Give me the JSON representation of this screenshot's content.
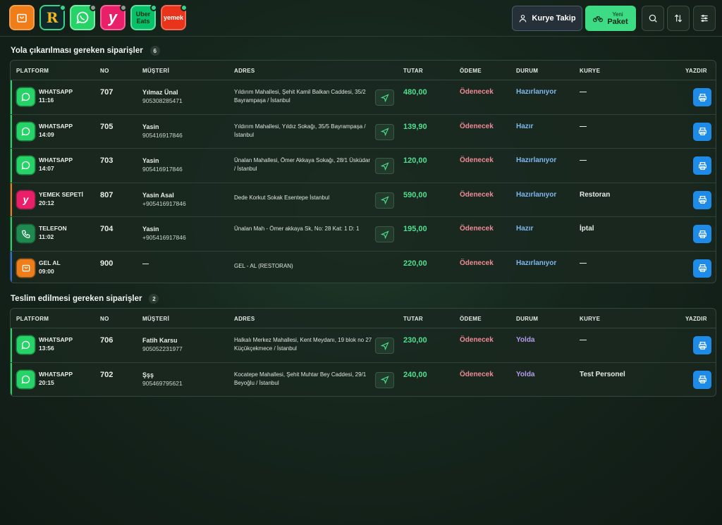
{
  "topbar": {
    "platforms": [
      {
        "name": "gel-al",
        "icon": "bag-icon",
        "color": "#ef7d1a",
        "status": "none"
      },
      {
        "name": "rpa",
        "icon": "r-app-icon",
        "color": "#0f2a2a",
        "status": "on",
        "label": "R"
      },
      {
        "name": "whatsapp",
        "icon": "whatsapp-icon",
        "color": "#25d366",
        "status": "off"
      },
      {
        "name": "yemeksepeti",
        "icon": "yemeksepeti-icon",
        "color": "#ea1f6a",
        "status": "off",
        "label": "y"
      },
      {
        "name": "ubereats",
        "icon": "ubereats-icon",
        "color": "#06c167",
        "status": "on",
        "label_top": "Uber",
        "label_bottom": "Eats"
      },
      {
        "name": "yemek",
        "icon": "yemek-icon",
        "color": "#e8341a",
        "status": "on",
        "label": "yemek"
      }
    ],
    "kurye_takip": "Kurye Takip",
    "yeni_small": "Yeni",
    "yeni_paket": "Paket"
  },
  "colors": {
    "accent": "#3ddc84",
    "total": "#4ee08e",
    "pay": "#f08a96",
    "print": "#1f8be8"
  },
  "headers": {
    "platform": "PLATFORM",
    "no": "NO",
    "musteri": "MÜŞTERİ",
    "adres": "ADRES",
    "tutar": "TUTAR",
    "odeme": "ÖDEME",
    "durum": "DURUM",
    "kurye": "KURYE",
    "yazdir": "YAZDIR"
  },
  "section1": {
    "title": "Yola çıkarılması gereken siparişler",
    "count": "6",
    "rows": [
      {
        "platform": "WHATSAPP",
        "time": "11:16",
        "no": "707",
        "name": "Yılmaz Ünal",
        "phone": "905308285471",
        "address": "Yıldırım Mahallesi, Şehit Kamil Balkan Caddesi, 35/2 Bayrampaşa / İstanbul",
        "total": "480,00",
        "payment": "Ödenecek",
        "status": "Hazırlanıyor",
        "courier": "—"
      },
      {
        "platform": "WHATSAPP",
        "time": "14:09",
        "no": "705",
        "name": "Yasin",
        "phone": "905416917846",
        "address": "Yıldırım Mahallesi, Yıldız Sokağı, 35/5 Bayrampaşa / İstanbul",
        "total": "139,90",
        "payment": "Ödenecek",
        "status": "Hazır",
        "courier": "—"
      },
      {
        "platform": "WHATSAPP",
        "time": "14:07",
        "no": "703",
        "name": "Yasin",
        "phone": "905416917846",
        "address": "Ünalan Mahallesi, Ömer Akkaya Sokağı, 28/1 Üsküdar / İstanbul",
        "total": "120,00",
        "payment": "Ödenecek",
        "status": "Hazırlanıyor",
        "courier": "—"
      },
      {
        "platform": "YEMEK SEPETİ",
        "time": "20:12",
        "no": "807",
        "name": "Yasin Asal",
        "phone": "+905416917846",
        "address": "Dede Korkut Sokak Esentepe İstanbul",
        "total": "590,00",
        "payment": "Ödenecek",
        "status": "Hazırlanıyor",
        "courier": "Restoran"
      },
      {
        "platform": "TELEFON",
        "time": "11:02",
        "no": "704",
        "name": "Yasin",
        "phone": "+905416917846",
        "address": "Ünalan Mah - Ömer akkaya Sk, No: 28 Kat: 1 D: 1",
        "total": "195,00",
        "payment": "Ödenecek",
        "status": "Hazır",
        "courier": "İptal"
      },
      {
        "platform": "GEL AL",
        "time": "09:00",
        "no": "900",
        "name": "—",
        "phone": "",
        "address": "GEL - AL (RESTORAN)",
        "total": "220,00",
        "payment": "Ödenecek",
        "status": "Hazırlanıyor",
        "courier": "—"
      }
    ]
  },
  "section2": {
    "title": "Teslim edilmesi gereken siparişler",
    "count": "2",
    "rows": [
      {
        "platform": "WHATSAPP",
        "time": "13:56",
        "no": "706",
        "name": "Fatih Karsu",
        "phone": "905052231977",
        "address": "Halkalı Merkez Mahallesi, Kent Meydanı, 19 blok no 27 Küçükçekmece / İstanbul",
        "total": "230,00",
        "payment": "Ödenecek",
        "status": "Yolda",
        "courier": "—"
      },
      {
        "platform": "WHATSAPP",
        "time": "20:15",
        "no": "702",
        "name": "Şşş",
        "phone": "905469795621",
        "address": "Kocatepe Mahallesi, Şehit Muhtar Bey Caddesi, 29/1 Beyoğlu / İstanbul",
        "total": "240,00",
        "payment": "Ödenecek",
        "status": "Yolda",
        "courier": "Test Personel"
      }
    ]
  }
}
